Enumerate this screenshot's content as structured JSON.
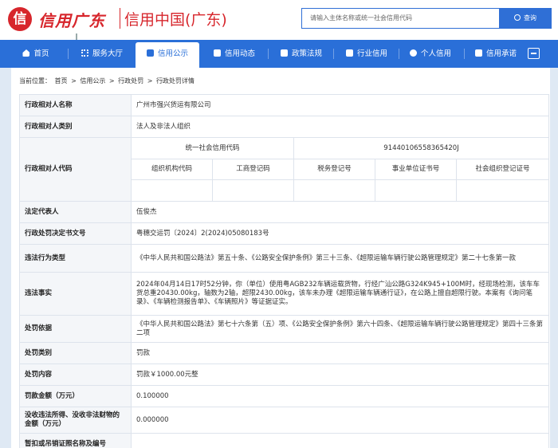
{
  "header": {
    "logo_mark": "信",
    "logo_script": "信用广东",
    "logo_text": "信用中国(广东)",
    "search_placeholder": "请输入主体名称或统一社会信用代码",
    "search_button": "查询",
    "accent": "#2a6fd8",
    "brand_red": "#d7262c"
  },
  "nav": {
    "items": [
      {
        "label": "首页",
        "icon": "home-icon"
      },
      {
        "label": "服务大厅",
        "icon": "grid-icon"
      },
      {
        "label": "信用公示",
        "icon": "notice-icon"
      },
      {
        "label": "信用动态",
        "icon": "document-icon"
      },
      {
        "label": "政策法规",
        "icon": "book-icon"
      },
      {
        "label": "行业信用",
        "icon": "building-icon"
      },
      {
        "label": "个人信用",
        "icon": "person-icon"
      },
      {
        "label": "信用承诺",
        "icon": "shield-icon"
      }
    ],
    "active": "信用公示"
  },
  "breadcrumb": {
    "prefix": "当前位置：",
    "items": [
      "首页",
      ">",
      "信用公示",
      ">",
      "行政处罚",
      ">",
      "行政处罚详情"
    ]
  },
  "detail": {
    "name_label": "行政相对人名称",
    "name_value": "广州市强兴货运有限公司",
    "category_label": "行政相对人类别",
    "category_value": "法人及非法人组织",
    "code_label": "行政相对人代码",
    "code_headers": {
      "uscc": "统一社会信用代码",
      "uscc_value": "91440106558365420J",
      "org": "组织机构代码",
      "biz": "工商登记码",
      "tax": "税务登记号",
      "inst": "事业单位证书号",
      "social": "社会组织登记证号"
    },
    "rep_label": "法定代表人",
    "rep_value": "伍俊杰",
    "doc_label": "行政处罚决定书文号",
    "doc_value": "粤穗交运罚〔2024〕2(2024)05080183号",
    "type_label": "违法行为类型",
    "type_value": "《中华人民共和国公路法》第五十条、《公路安全保护条例》第三十三条、《超限运输车辆行驶公路管理规定》第二十七条第一款",
    "fact_label": "违法事实",
    "fact_value": "2024年04月14日17时52分钟，你（单位）使用粤AGB232车辆运载货物，行经广汕公路G324K945+100M时，经现场检测，该车车货总重20430.00kg，轴数为2轴，超限2430.00kg，该车未办理《超限运输车辆通行证》，在公路上擅自超限行驶。本案有《询问笔录》、《车辆检测报告单》、《车辆照片》等证据证实。",
    "basis_label": "处罚依据",
    "basis_value": "《中华人民共和国公路法》第七十六条第（五）项、《公路安全保护条例》第六十四条、《超限运输车辆行驶公路管理规定》第四十三条第二项",
    "kind_label": "处罚类别",
    "kind_value": "罚款",
    "content_label": "处罚内容",
    "content_value": "罚款￥1000.00元整",
    "amount_label": "罚款金额（万元）",
    "amount_value": "0.100000",
    "confiscate_label": "没收违法所得、没收非法财物的金额（万元）",
    "confiscate_value": "0.000000",
    "license_label": "暂扣或吊销证照名称及编号",
    "license_value": ""
  }
}
